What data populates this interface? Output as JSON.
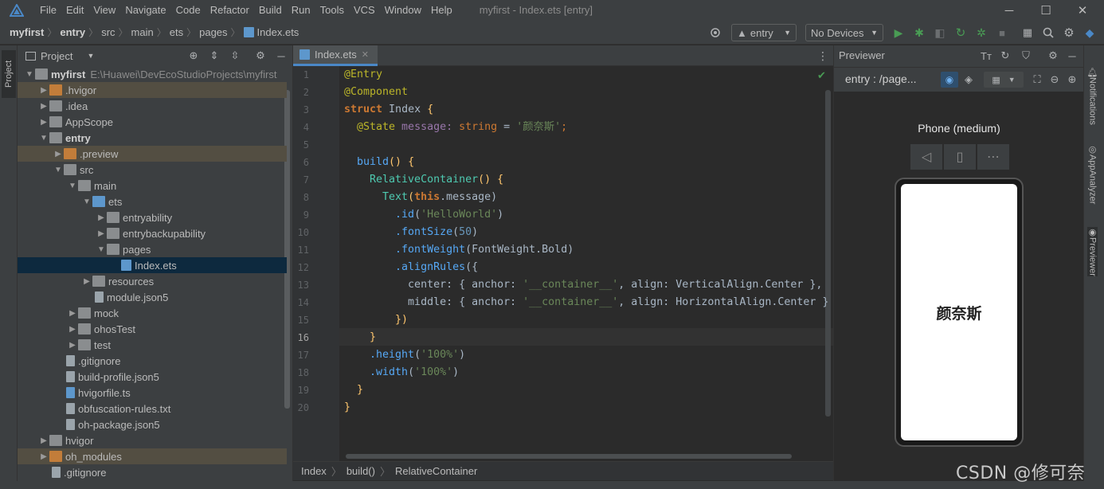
{
  "menubar": {
    "items": [
      "File",
      "Edit",
      "View",
      "Navigate",
      "Code",
      "Refactor",
      "Build",
      "Run",
      "Tools",
      "VCS",
      "Window",
      "Help"
    ],
    "window_title": "myfirst - Index.ets [entry]",
    "controls": {
      "minimize": "─",
      "maximize": "☐",
      "close": "✕"
    }
  },
  "breadcrumb": {
    "items": [
      "myfirst",
      "entry",
      "src",
      "main",
      "ets",
      "pages",
      "Index.ets"
    ]
  },
  "toolbar": {
    "module_combo": "entry",
    "device_combo": "No Devices"
  },
  "left_strip": {
    "label": "Project"
  },
  "project_panel": {
    "title": "Project",
    "tree": [
      {
        "label": "myfirst",
        "path": "E:\\Huawei\\DevEcoStudioProjects\\myfirst",
        "bold": true
      },
      {
        "label": ".hvigor"
      },
      {
        "label": ".idea"
      },
      {
        "label": "AppScope"
      },
      {
        "label": "entry",
        "bold": true
      },
      {
        "label": ".preview"
      },
      {
        "label": "src"
      },
      {
        "label": "main"
      },
      {
        "label": "ets"
      },
      {
        "label": "entryability"
      },
      {
        "label": "entrybackupability"
      },
      {
        "label": "pages"
      },
      {
        "label": "Index.ets"
      },
      {
        "label": "resources"
      },
      {
        "label": "module.json5"
      },
      {
        "label": "mock"
      },
      {
        "label": "ohosTest"
      },
      {
        "label": "test"
      },
      {
        "label": ".gitignore"
      },
      {
        "label": "build-profile.json5"
      },
      {
        "label": "hvigorfile.ts"
      },
      {
        "label": "obfuscation-rules.txt"
      },
      {
        "label": "oh-package.json5"
      },
      {
        "label": "hvigor"
      },
      {
        "label": "oh_modules"
      },
      {
        "label": ".gitignore"
      }
    ]
  },
  "editor": {
    "tab": "Index.ets",
    "line_numbers": [
      "1",
      "2",
      "3",
      "4",
      "5",
      "6",
      "7",
      "8",
      "9",
      "10",
      "11",
      "12",
      "13",
      "14",
      "15",
      "16",
      "17",
      "18",
      "19",
      "20"
    ],
    "code": {
      "l1": "@Entry",
      "l2": "@Component",
      "l3a": "struct",
      "l3b": " Index ",
      "l3c": "{",
      "l4a": "  @State",
      "l4b": " message: ",
      "l4c": "string",
      "l4d": " = ",
      "l4e": "'颜奈斯'",
      "l4f": ";",
      "l6a": "  build",
      "l6b": "() {",
      "l7a": "    RelativeContainer",
      "l7b": "() {",
      "l8a": "      Text",
      "l8b": "(",
      "l8c": "this",
      "l8d": ".message)",
      "l9a": "        .id",
      "l9b": "(",
      "l9c": "'HelloWorld'",
      "l9d": ")",
      "l10a": "        .fontSize",
      "l10b": "(",
      "l10c": "50",
      "l10d": ")",
      "l11a": "        .fontWeight",
      "l11b": "(FontWeight.Bold)",
      "l12a": "        .alignRules",
      "l12b": "({",
      "l13a": "          center: { anchor: ",
      "l13b": "'__container__'",
      "l13c": ", align: VerticalAlign.Center },",
      "l14a": "          middle: { anchor: ",
      "l14b": "'__container__'",
      "l14c": ", align: HorizontalAlign.Center }",
      "l15": "        })",
      "l16": "    }",
      "l17a": "    .height",
      "l17b": "(",
      "l17c": "'100%'",
      "l17d": ")",
      "l18a": "    .width",
      "l18b": "(",
      "l18c": "'100%'",
      "l18d": ")",
      "l19": "  }",
      "l20": "}"
    },
    "status_crumbs": [
      "Index",
      "build()",
      "RelativeContainer"
    ]
  },
  "previewer": {
    "title": "Previewer",
    "page_combo": "entry : /page...",
    "device_label": "Phone (medium)",
    "screen_text": "颜奈斯"
  },
  "right_strip": {
    "items": [
      "Notifications",
      "AppAnalyzer",
      "Previewer"
    ]
  },
  "watermark": "CSDN @修可奈",
  "colors": {
    "accent": "#4a88c7",
    "run_green": "#499c54",
    "highlight_row": "#534e42",
    "selected_row": "#0d293e"
  }
}
